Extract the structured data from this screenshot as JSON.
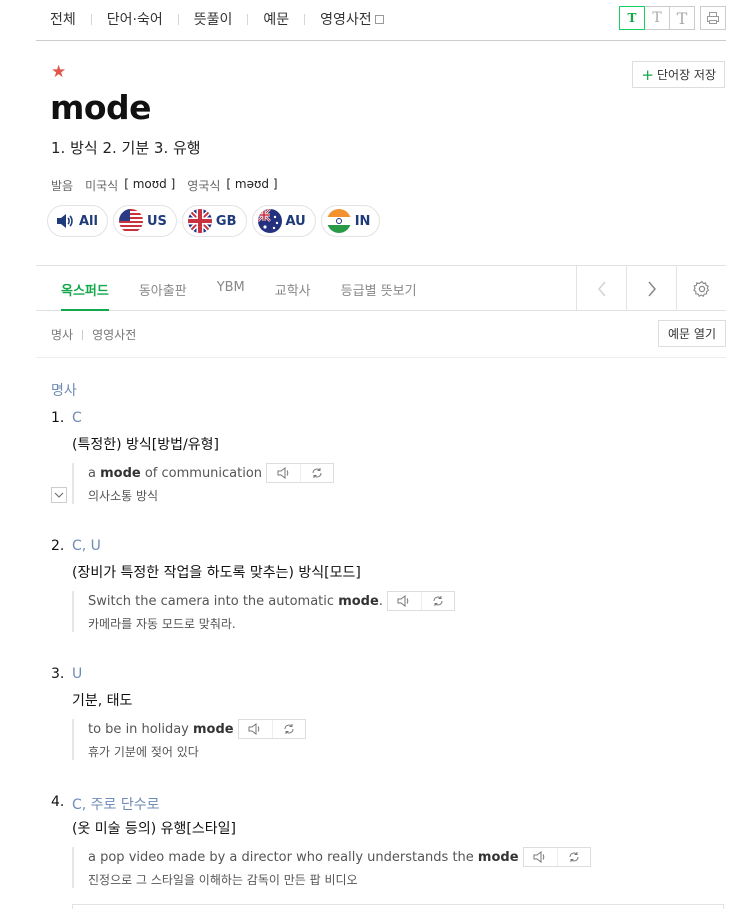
{
  "nav": {
    "tabs": [
      "전체",
      "단어·숙어",
      "뜻풀이",
      "예문",
      "영영사전"
    ],
    "font_sizes": [
      "T",
      "T",
      "T"
    ]
  },
  "word": {
    "headword": "mode",
    "save_label": "단어장 저장",
    "meanings": "1. 방식 2. 기분 3. 유행",
    "pron_label": "발음",
    "us_label": "미국식",
    "us_ipa": "[ moʊd ]",
    "uk_label": "영국식",
    "uk_ipa": "[ məʊd ]"
  },
  "audio": [
    "All",
    "US",
    "GB",
    "AU",
    "IN"
  ],
  "sources": {
    "tabs": [
      "옥스퍼드",
      "동아출판",
      "YBM",
      "교학사",
      "등급별 뜻보기"
    ],
    "active_index": 0
  },
  "sub": {
    "links": [
      "명사",
      "영영사전"
    ],
    "example_open": "예문 열기"
  },
  "pos_label": "명사",
  "entries": [
    {
      "num": "1.",
      "gram": "C",
      "def": "(특정한) 방식[방법/유형]",
      "ex_before": "a ",
      "ex_bold": "mode",
      "ex_after": " of communication",
      "ex_ko": "의사소통 방식"
    },
    {
      "num": "2.",
      "gram": "C, U",
      "def": "(장비가 특정한 작업을 하도록 맞추는) 방식[모드]",
      "ex_before": "Switch the camera into the automatic ",
      "ex_bold": "mode",
      "ex_after": ".",
      "ex_ko": "카메라를 자동 모드로 맞춰라."
    },
    {
      "num": "3.",
      "gram": "U",
      "def": "기분, 태도",
      "ex_before": "to be in holiday ",
      "ex_bold": "mode",
      "ex_after": "",
      "ex_ko": "휴가 기분에 젖어 있다"
    },
    {
      "num": "4.",
      "gram": "C, 주로 단수로",
      "def": "(옷 미술 등의) 유행[스타일]",
      "ex_before": "a pop video made by a director who really understands the ",
      "ex_bold": "mode",
      "ex_after": "",
      "ex_ko": "진정으로 그 스타일을 이해하는 감독이 만든 팝 비디오"
    }
  ],
  "colors": {
    "accent": "#13a84a",
    "star": "#e0564a",
    "pos": "#6f8bb8"
  }
}
